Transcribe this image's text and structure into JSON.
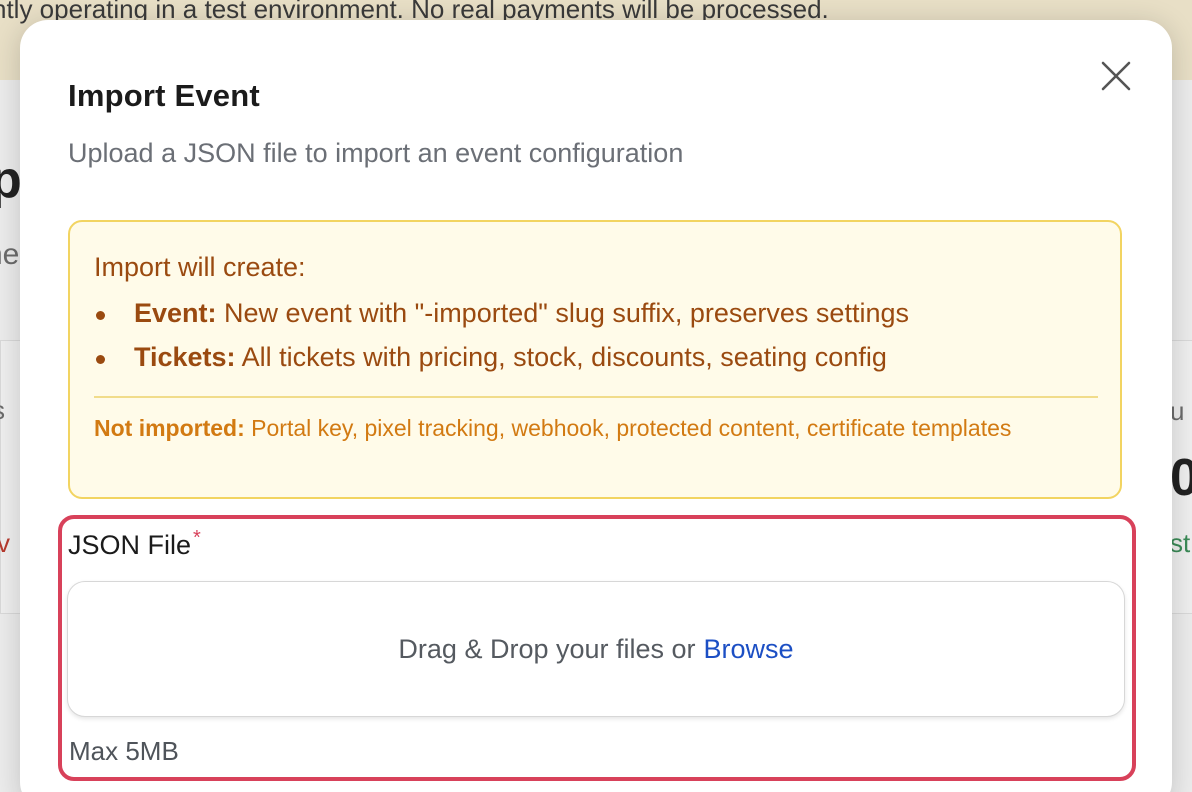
{
  "background": {
    "banner_text": "ntly operating in a test environment. No real payments will be processed.",
    "fragments": {
      "left_big": "p",
      "left_mid": "ne",
      "left_small": "s",
      "left_red": "tiv",
      "right_small": "u",
      "right_big": "0",
      "right_green": "st"
    }
  },
  "modal": {
    "title": "Import Event",
    "subtitle": "Upload a JSON file to import an event configuration",
    "close_icon": "close-icon"
  },
  "notice": {
    "heading": "Import will create:",
    "items": [
      {
        "label": "Event:",
        "text": " New event with \"-imported\" slug suffix, preserves settings"
      },
      {
        "label": "Tickets:",
        "text": " All tickets with pricing, stock, discounts, seating config"
      }
    ],
    "footer_label": "Not imported:",
    "footer_text": " Portal key, pixel tracking, webhook, protected content, certificate templates",
    "colors": {
      "background": "#fffbe9",
      "border": "#f2d461",
      "text": "#9a4a10",
      "footer": "#d27a12"
    }
  },
  "field": {
    "label": "JSON File",
    "required_marker": "*",
    "dropzone_text": "Drag & Drop your files or",
    "browse_label": "Browse",
    "hint": "Max 5MB",
    "highlight_color": "#d8415a"
  }
}
